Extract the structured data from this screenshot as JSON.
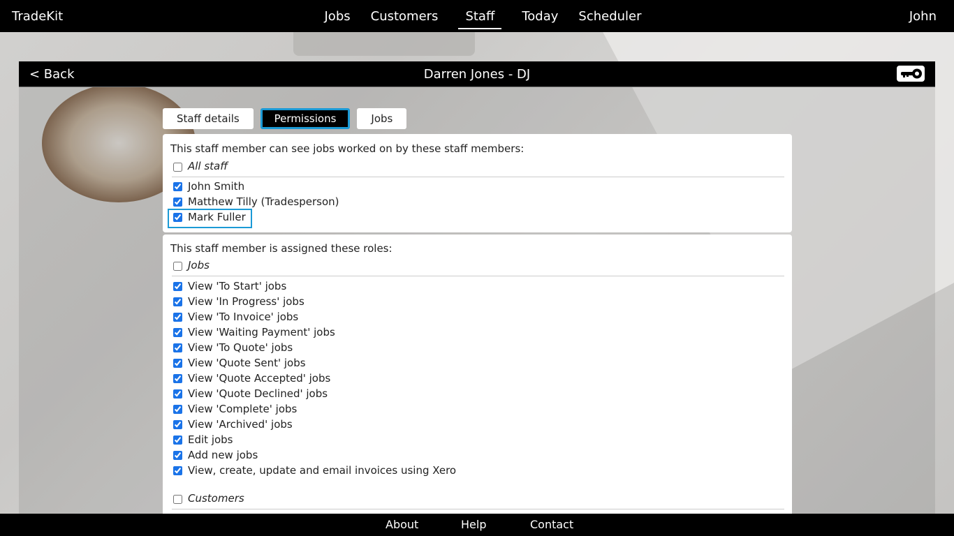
{
  "app": {
    "brand": "TradeKit",
    "user": "John"
  },
  "nav": [
    {
      "label": "Jobs"
    },
    {
      "label": "Customers"
    },
    {
      "label": "Staff",
      "active": true
    },
    {
      "label": "Today"
    },
    {
      "label": "Scheduler"
    }
  ],
  "panel": {
    "back_label": "< Back",
    "title": "Darren Jones - DJ",
    "key_icon": "key-icon"
  },
  "tabs": [
    {
      "label": "Staff details"
    },
    {
      "label": "Permissions",
      "active": true
    },
    {
      "label": "Jobs"
    }
  ],
  "visibility": {
    "intro": "This staff member can see jobs worked on by these staff members:",
    "all_label": "All staff",
    "all_checked": false,
    "staff": [
      {
        "label": "John Smith",
        "checked": true
      },
      {
        "label": "Matthew Tilly (Tradesperson)",
        "checked": true
      },
      {
        "label": "Mark Fuller",
        "checked": true
      }
    ]
  },
  "roles": {
    "intro": "This staff member is assigned these roles:",
    "groups": [
      {
        "label": "Jobs",
        "checked": false,
        "items": [
          {
            "label": "View 'To Start' jobs",
            "checked": true
          },
          {
            "label": "View 'In Progress' jobs",
            "checked": true
          },
          {
            "label": "View 'To Invoice' jobs",
            "checked": true
          },
          {
            "label": "View 'Waiting Payment' jobs",
            "checked": true
          },
          {
            "label": "View 'To Quote' jobs",
            "checked": true
          },
          {
            "label": "View 'Quote Sent' jobs",
            "checked": true
          },
          {
            "label": "View 'Quote Accepted' jobs",
            "checked": true
          },
          {
            "label": "View 'Quote Declined' jobs",
            "checked": true
          },
          {
            "label": "View 'Complete' jobs",
            "checked": true
          },
          {
            "label": "View 'Archived' jobs",
            "checked": true
          },
          {
            "label": "Edit jobs",
            "checked": true
          },
          {
            "label": "Add new jobs",
            "checked": true
          },
          {
            "label": "View, create, update and email invoices using Xero",
            "checked": true
          }
        ]
      },
      {
        "label": "Customers",
        "checked": false,
        "items": []
      }
    ]
  },
  "footer": [
    {
      "label": "About"
    },
    {
      "label": "Help"
    },
    {
      "label": "Contact"
    }
  ],
  "colors": {
    "accent": "#1b9ad6",
    "bar": "#000000"
  }
}
